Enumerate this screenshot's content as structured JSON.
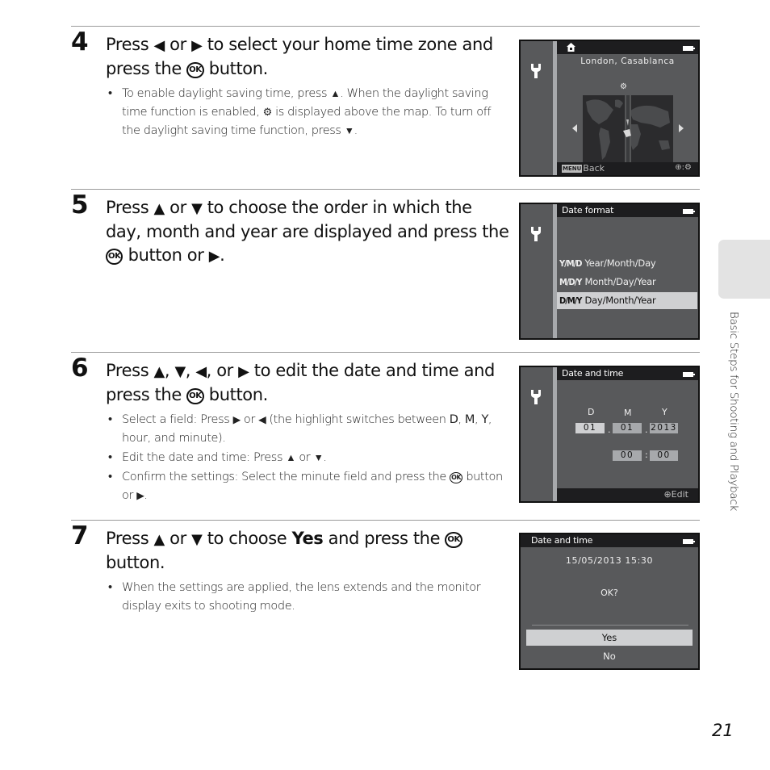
{
  "steps": [
    {
      "number": "4",
      "title_parts": [
        "Press ",
        "◀",
        " or ",
        "▶",
        " to select your home time zone and press the ",
        "OK",
        " button."
      ],
      "bullets": [
        {
          "parts": [
            "To enable daylight saving time, press ",
            "▲",
            ". When the daylight saving time function is enabled, ",
            "DST",
            " is displayed above the map. To turn off the daylight saving time function, press ",
            "▼",
            "."
          ]
        }
      ]
    },
    {
      "number": "5",
      "title_parts": [
        "Press ",
        "▲",
        " or ",
        "▼",
        " to choose the order in which the day, month and year are displayed and press the ",
        "OK",
        " button or ",
        "▶",
        "."
      ],
      "bullets": []
    },
    {
      "number": "6",
      "title_parts": [
        "Press ",
        "▲",
        ", ",
        "▼",
        ", ",
        "◀",
        ", or ",
        "▶",
        " to edit the date and time and press the ",
        "OK",
        " button."
      ],
      "bullets": [
        {
          "parts": [
            "Select a field: Press ",
            "▶",
            " or ",
            "◀",
            " (the highlight switches between ",
            "D",
            ", ",
            "M",
            ", ",
            "Y",
            ", hour, and minute)."
          ]
        },
        {
          "parts": [
            "Edit the date and time: Press ",
            "▲",
            " or ",
            "▼",
            "."
          ]
        },
        {
          "parts": [
            "Confirm the settings: Select the minute field and press the ",
            "OK",
            " button or ",
            "▶",
            "."
          ]
        }
      ]
    },
    {
      "number": "7",
      "title_parts": [
        "Press ",
        "▲",
        " or ",
        "▼",
        " to choose ",
        "Yes",
        " and press the ",
        "OK",
        " button."
      ],
      "bullets": [
        {
          "parts": [
            "When the settings are applied, the lens extends and the monitor display exits to shooting mode."
          ]
        }
      ]
    }
  ],
  "icons": {
    "ok_button": "OK",
    "left": "◀",
    "right": "▶",
    "up": "▲",
    "down": "▼",
    "dst": "⚙"
  },
  "screens": {
    "time_zone": {
      "city": "London, Casablanca",
      "back_chip": "MENU",
      "back_label": "Back",
      "dst_hint": "⊕:⚙"
    },
    "date_format": {
      "title": "Date format",
      "options": [
        {
          "code": "Y/M/D",
          "label": "Year/Month/Day",
          "selected": false
        },
        {
          "code": "M/D/Y",
          "label": "Month/Day/Year",
          "selected": false
        },
        {
          "code": "D/M/Y",
          "label": "Day/Month/Year",
          "selected": true
        }
      ]
    },
    "date_time_edit": {
      "title": "Date and time",
      "labels": {
        "d": "D",
        "m": "M",
        "y": "Y"
      },
      "day": "01",
      "month": "01",
      "year": "2013",
      "date_sep": ".",
      "hour": "00",
      "minute": "00",
      "time_sep": ":",
      "edit_hint": "⊕Edit"
    },
    "confirm": {
      "title": "Date and time",
      "value": "15/05/2013  15:30",
      "question": "OK?",
      "options": [
        {
          "label": "Yes",
          "selected": true
        },
        {
          "label": "No",
          "selected": false
        }
      ]
    }
  },
  "side_section": "Basic Steps for Shooting and Playback",
  "page_number": "21"
}
